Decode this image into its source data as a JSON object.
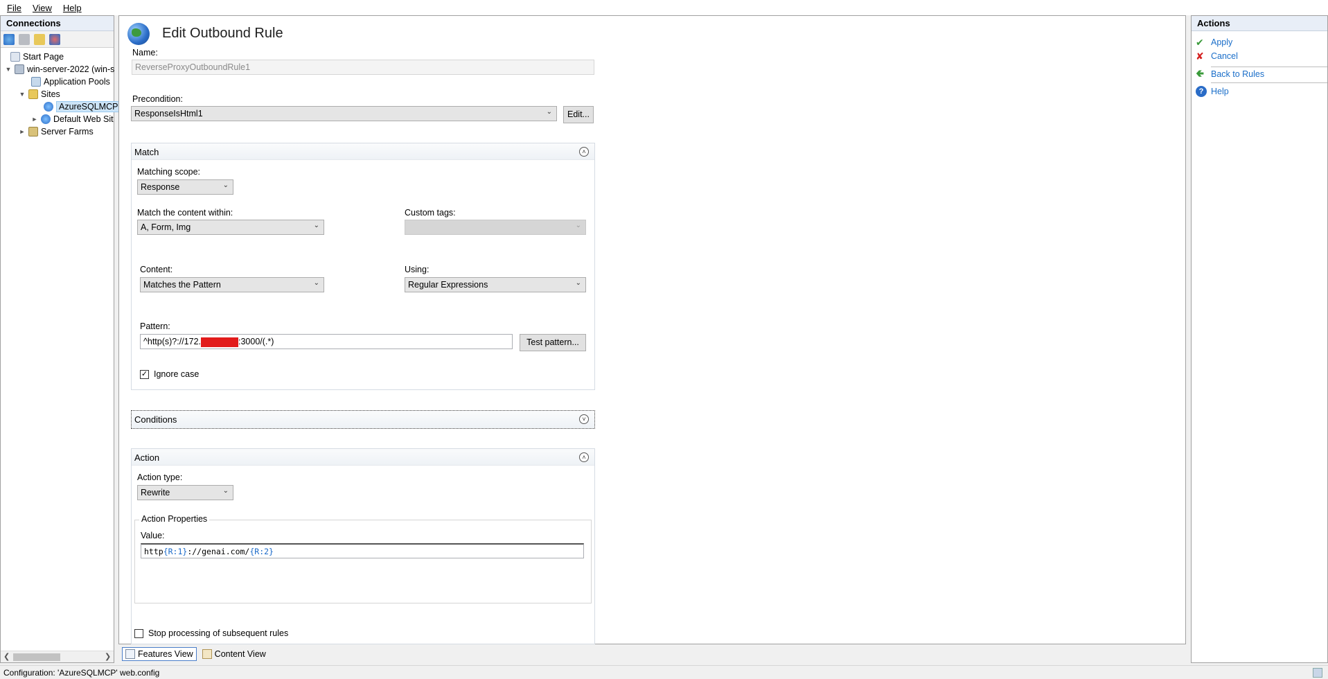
{
  "menu": {
    "file": "File",
    "view": "View",
    "help": "Help"
  },
  "connections": {
    "header": "Connections",
    "tree": [
      {
        "label": "Start Page"
      },
      {
        "label": "win-server-2022 (win-s"
      },
      {
        "label": "Application Pools"
      },
      {
        "label": "Sites"
      },
      {
        "label": "AzureSQLMCP"
      },
      {
        "label": "Default Web Sit"
      },
      {
        "label": "Server Farms"
      }
    ]
  },
  "page": {
    "title": "Edit Outbound Rule"
  },
  "form": {
    "name_label": "Name:",
    "name_value": "ReverseProxyOutboundRule1",
    "precondition_label": "Precondition:",
    "precondition_value": "ResponseIsHtml1",
    "edit_button": "Edit...",
    "match": {
      "title": "Match",
      "scope_label": "Matching scope:",
      "scope_value": "Response",
      "within_label": "Match the content within:",
      "within_value": "A, Form, Img",
      "custom_tags_label": "Custom tags:",
      "custom_tags_value": "",
      "content_label": "Content:",
      "content_value": "Matches the Pattern",
      "using_label": "Using:",
      "using_value": "Regular Expressions",
      "pattern_label": "Pattern:",
      "pattern_prefix": "^http(s)?://172.",
      "pattern_suffix": ":3000/(.*)",
      "test_button": "Test pattern...",
      "ignore_case_label": "Ignore case",
      "ignore_case_checked": true
    },
    "conditions": {
      "title": "Conditions"
    },
    "action": {
      "title": "Action",
      "type_label": "Action type:",
      "type_value": "Rewrite",
      "props_legend": "Action Properties",
      "value_label": "Value:",
      "value_tokens": [
        "http",
        "{R:1}",
        "://genai.com/",
        "{R:2}"
      ],
      "stop_label": "Stop processing of subsequent rules",
      "stop_checked": false
    }
  },
  "bottom_tabs": {
    "features": "Features View",
    "content": "Content View"
  },
  "actions": {
    "header": "Actions",
    "apply": "Apply",
    "cancel": "Cancel",
    "back": "Back to Rules",
    "help": "Help"
  },
  "status": {
    "text": "Configuration: 'AzureSQLMCP' web.config"
  },
  "colors": {
    "link": "#1a6ec9",
    "redaction": "#e21b1b",
    "selection": "#cce4f7"
  }
}
